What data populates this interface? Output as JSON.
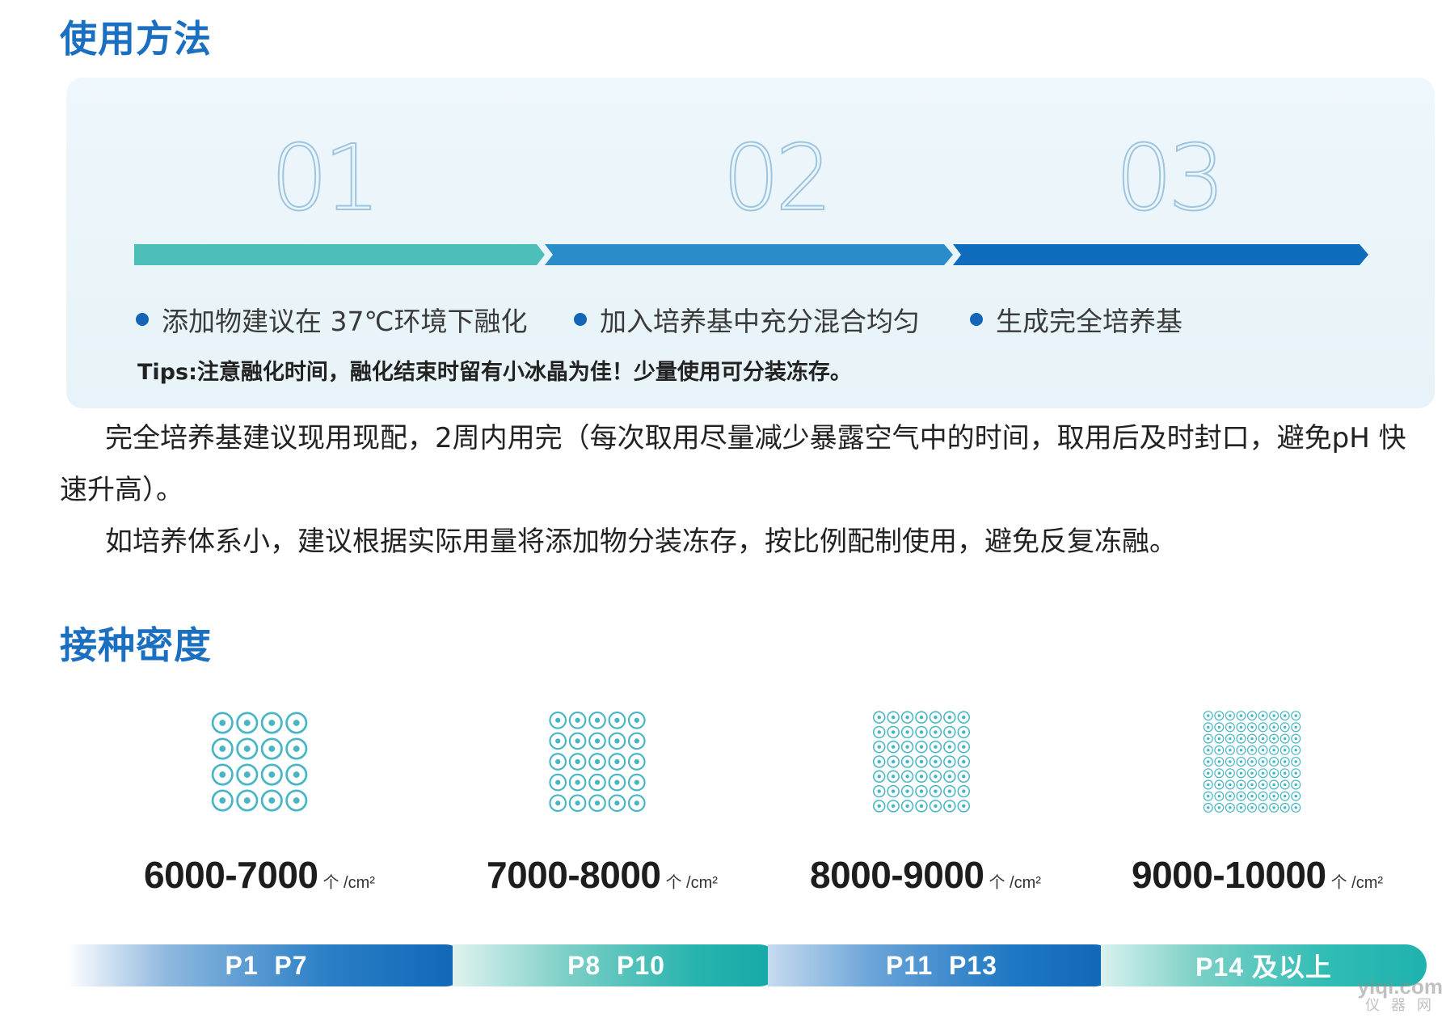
{
  "usage": {
    "title": "使用方法",
    "steps": [
      {
        "number": "01",
        "text": "添加物建议在 37℃环境下融化"
      },
      {
        "number": "02",
        "text": "加入培养基中充分混合均匀"
      },
      {
        "number": "03",
        "text": "生成完全培养基"
      }
    ],
    "tips": "Tips:注意融化时间，融化结束时留有小冰晶为佳！少量使用可分装冻存。",
    "colors": {
      "step1": "#4bbfb8",
      "step2": "#2a8cc8",
      "step3": "#0f6cbd"
    }
  },
  "paragraphs": {
    "p1": "完全培养基建议现用现配，2周内用完（每次取用尽量减少暴露空气中的时间，取用后及时封口，避免pH 快速升高）。",
    "p2": "如培养体系小，建议根据实际用量将添加物分装冻存，按比例配制使用，避免反复冻融。"
  },
  "density": {
    "title": "接种密度",
    "unit": "个 /cm²",
    "items": [
      {
        "range": "6000-7000",
        "passage": "P1  P7"
      },
      {
        "range": "7000-8000",
        "passage": "P8  P10"
      },
      {
        "range": "8000-9000",
        "passage": "P11  P13"
      },
      {
        "range": "9000-10000",
        "passage": "P14 及以上"
      }
    ],
    "icon": "cell-density-pattern-icon",
    "colors": {
      "title": "#1b6fc0",
      "cell": "#46b6c4"
    }
  },
  "watermark": {
    "top": "yiqi.com",
    "bottom": "仪器网"
  }
}
